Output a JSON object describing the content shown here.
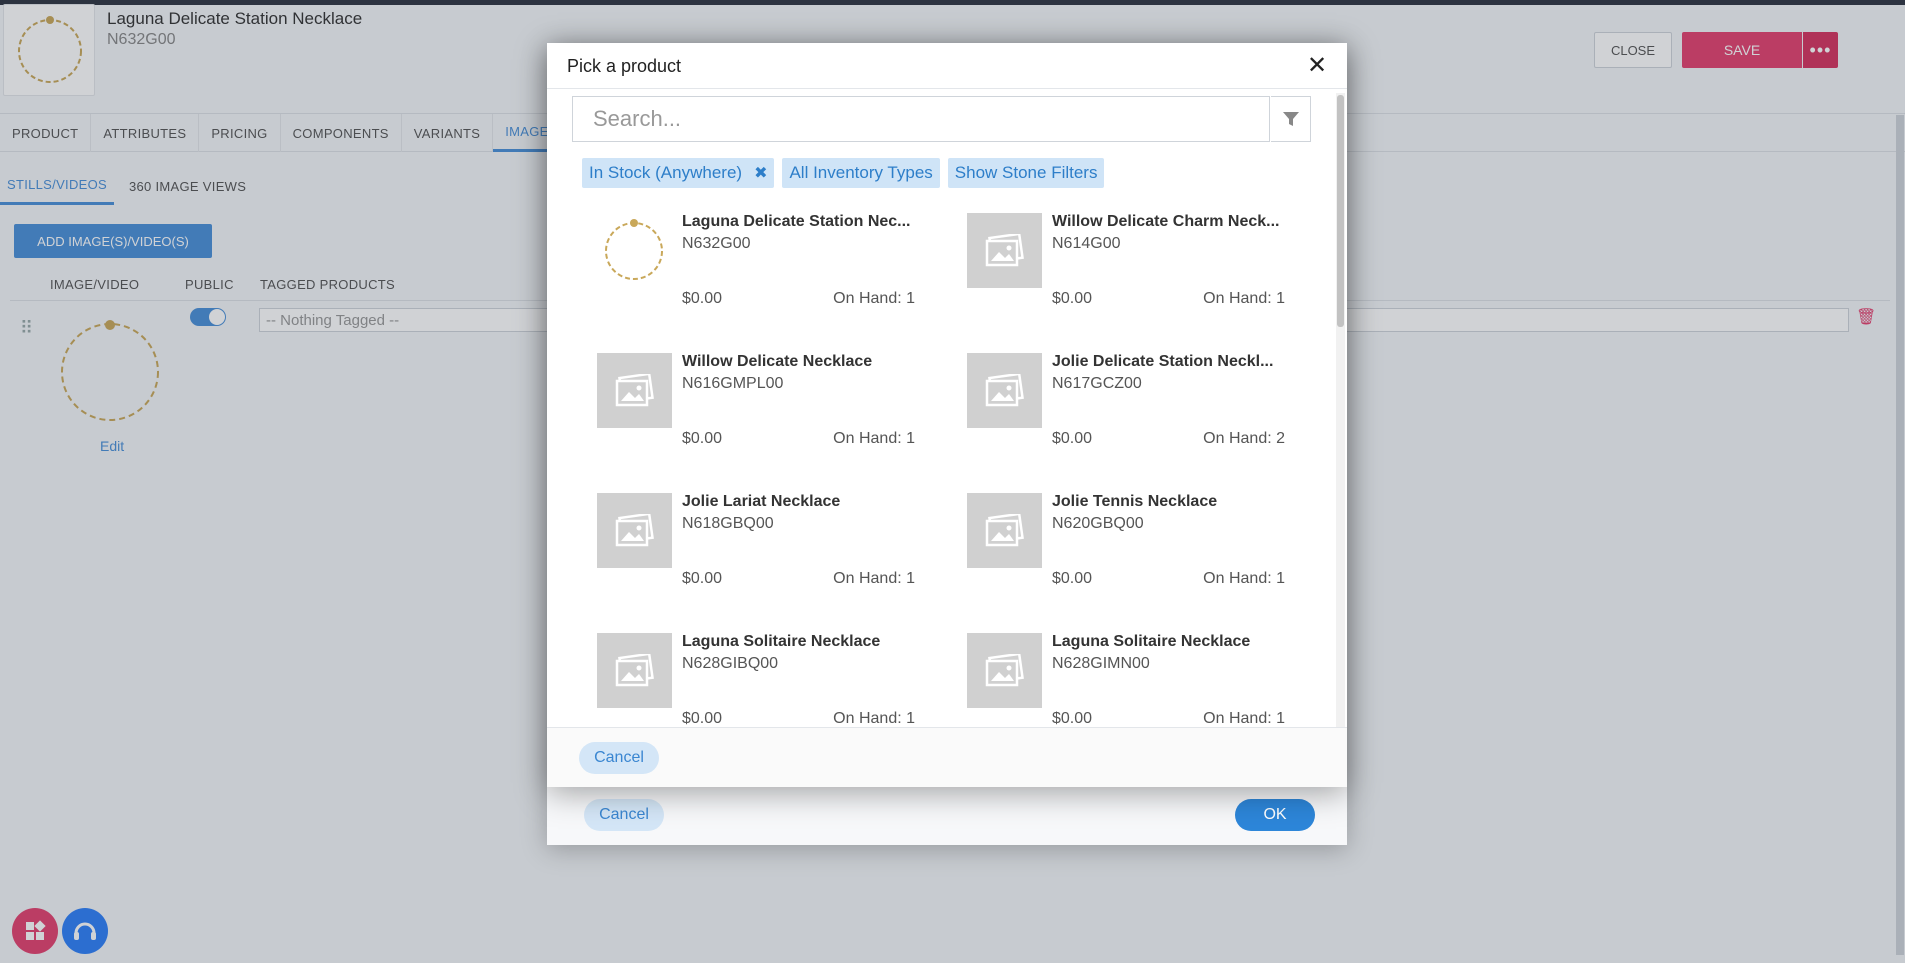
{
  "header": {
    "product_name": "Laguna Delicate Station Necklace",
    "product_sku": "N632G00",
    "close_label": "CLOSE",
    "save_label": "SAVE",
    "more_label": "•••"
  },
  "tabs": [
    {
      "label": "PRODUCT"
    },
    {
      "label": "ATTRIBUTES"
    },
    {
      "label": "PRICING"
    },
    {
      "label": "COMPONENTS"
    },
    {
      "label": "VARIANTS"
    },
    {
      "label": "IMAGES"
    }
  ],
  "subtabs": [
    {
      "label": "STILLS/VIDEOS"
    },
    {
      "label": "360 IMAGE VIEWS"
    }
  ],
  "images_section": {
    "add_label": "ADD IMAGE(S)/VIDEO(S)",
    "col_image": "IMAGE/VIDEO",
    "col_public": "PUBLIC",
    "col_tagged": "TAGGED PRODUCTS",
    "edit_label": "Edit",
    "tag_placeholder": "-- Nothing Tagged --"
  },
  "under_modal": {
    "cancel_label": "Cancel",
    "ok_label": "OK"
  },
  "picker": {
    "title": "Pick a product",
    "close_glyph": "✕",
    "search_placeholder": "Search...",
    "chips": [
      {
        "label": "In Stock (Anywhere)",
        "removable": "✖"
      },
      {
        "label": "All Inventory Types"
      },
      {
        "label": "Show Stone Filters"
      }
    ],
    "products": [
      {
        "name": "Laguna Delicate Station Nec...",
        "sku": "N632G00",
        "price": "$0.00",
        "on_hand": "On Hand: 1"
      },
      {
        "name": "Willow Delicate Charm Neck...",
        "sku": "N614G00",
        "price": "$0.00",
        "on_hand": "On Hand: 1"
      },
      {
        "name": "Willow Delicate Necklace",
        "sku": "N616GMPL00",
        "price": "$0.00",
        "on_hand": "On Hand: 1"
      },
      {
        "name": "Jolie Delicate Station Neckl...",
        "sku": "N617GCZ00",
        "price": "$0.00",
        "on_hand": "On Hand: 2"
      },
      {
        "name": "Jolie Lariat Necklace",
        "sku": "N618GBQ00",
        "price": "$0.00",
        "on_hand": "On Hand: 1"
      },
      {
        "name": "Jolie Tennis Necklace",
        "sku": "N620GBQ00",
        "price": "$0.00",
        "on_hand": "On Hand: 1"
      },
      {
        "name": "Laguna Solitaire Necklace",
        "sku": "N628GIBQ00",
        "price": "$0.00",
        "on_hand": "On Hand: 1"
      },
      {
        "name": "Laguna Solitaire Necklace",
        "sku": "N628GIMN00",
        "price": "$0.00",
        "on_hand": "On Hand: 1"
      }
    ],
    "cancel_label": "Cancel"
  },
  "colors": {
    "accent": "#4a90d9",
    "save": "#e4406f",
    "chip_bg": "#cfe4f7"
  }
}
